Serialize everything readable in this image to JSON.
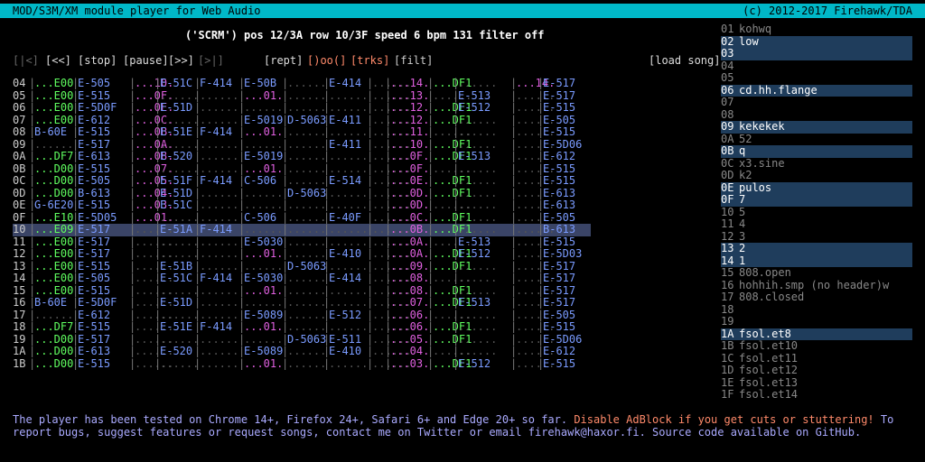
{
  "titlebar": {
    "left": "MOD/S3M/XM module player for Web Audio",
    "right": "(c) 2012-2017 Firehawk/TDA"
  },
  "status": {
    "song": "('SCRM')",
    "pos_label": "pos",
    "pos": "12/3A",
    "row_label": "row",
    "row": "10/3F",
    "speed_label": "speed",
    "speed": "6",
    "bpm_label": "bpm",
    "bpm": "131",
    "filter_label": "filter",
    "filter": "off"
  },
  "controls": {
    "prev": "[|<]",
    "rew": "[<<]",
    "stop": "[stop]",
    "pause": "[pause]",
    "fwd": "[>>]",
    "next": "[>|]",
    "rept": "[rept]",
    "oo": "[)oo(]",
    "trks": "[trks]",
    "filt": "[filt]",
    "load": "[load song]"
  },
  "pattern": {
    "current_row_index": 12,
    "rows": [
      {
        "n": "04",
        "c": [
          "...E00",
          "E-505",
          "...10.",
          "E-51C",
          "F-414",
          "E-50B",
          "......",
          "E-414",
          "......",
          "...14.",
          "...DF1",
          "......",
          "...14.",
          "E-517"
        ]
      },
      {
        "n": "05",
        "c": [
          "...E00",
          "E-515",
          "...0F.",
          "......",
          "......",
          "...01.",
          "......",
          "......",
          "......",
          "...13.",
          "......",
          "E-513",
          "......",
          "E-517"
        ]
      },
      {
        "n": "06",
        "c": [
          "...E00",
          "E-5D0F",
          "...0E.",
          "E-51D",
          "......",
          "......",
          "......",
          "......",
          "......",
          "...12.",
          "...DF1",
          "E-512",
          "......",
          "E-515"
        ]
      },
      {
        "n": "07",
        "c": [
          "...E00",
          "E-612",
          "...0C.",
          "......",
          "......",
          "E-5019",
          "D-5063",
          "E-411",
          "......",
          "...12.",
          "...DF1",
          "......",
          "......",
          "E-505"
        ]
      },
      {
        "n": "08",
        "c": [
          "B-60E",
          "E-515",
          "...0B.",
          "E-51E",
          "F-414",
          "...01.",
          "......",
          "......",
          "......",
          "...11.",
          "......",
          "......",
          "......",
          "E-515"
        ]
      },
      {
        "n": "09",
        "c": [
          "......",
          "E-517",
          "...0A.",
          "......",
          "......",
          "......",
          "......",
          "E-411",
          "......",
          "...10.",
          "...DF1",
          "......",
          "......",
          "E-5D06"
        ]
      },
      {
        "n": "0A",
        "c": [
          "...DF7",
          "E-613",
          "...08.",
          "E-520",
          "......",
          "E-5019",
          "......",
          "......",
          "......",
          "...0F.",
          "...DF1",
          "E-513",
          "......",
          "E-612"
        ]
      },
      {
        "n": "0B",
        "c": [
          "...D00",
          "E-515",
          "...07.",
          "......",
          "......",
          "...01.",
          "......",
          "......",
          "......",
          "...0F.",
          "......",
          "......",
          "......",
          "E-515"
        ]
      },
      {
        "n": "0C",
        "c": [
          "...D00",
          "E-505",
          "...05.",
          "E-51F",
          "F-414",
          "C-506",
          "......",
          "E-514",
          "......",
          "...0E.",
          "...DF1",
          "......",
          "......",
          "E-515"
        ]
      },
      {
        "n": "0D",
        "c": [
          "...D00",
          "B-613",
          "...04.",
          "E-51D",
          "......",
          "......",
          "D-5063",
          "......",
          "......",
          "...0D.",
          "...DF1",
          "......",
          "......",
          "E-613"
        ]
      },
      {
        "n": "0E",
        "c": [
          "G-6E20",
          "E-515",
          "...03.",
          "E-51C",
          "......",
          "......",
          "......",
          "......",
          "......",
          "...0D.",
          "......",
          "......",
          "......",
          "E-613"
        ]
      },
      {
        "n": "0F",
        "c": [
          "...E10",
          "E-5D05",
          "...01.",
          "......",
          "......",
          "C-506",
          "......",
          "E-40F",
          "......",
          "...0C.",
          "...DF1",
          "......",
          "......",
          "E-505"
        ]
      },
      {
        "n": "10",
        "c": [
          "...E09",
          "E-517",
          "......",
          "E-51A",
          "F-414",
          "......",
          "......",
          "......",
          "......",
          "...0B.",
          "...DF1",
          "......",
          "......",
          "B-613"
        ]
      },
      {
        "n": "11",
        "c": [
          "...E00",
          "E-517",
          "......",
          "......",
          "......",
          "E-5030",
          "......",
          "......",
          "......",
          "...0A.",
          "......",
          "E-513",
          "......",
          "E-515"
        ]
      },
      {
        "n": "12",
        "c": [
          "...E00",
          "E-517",
          "......",
          "......",
          "......",
          "...01.",
          "......",
          "E-410",
          "......",
          "...0A.",
          "...DF1",
          "E-512",
          "......",
          "E-5D03"
        ]
      },
      {
        "n": "13",
        "c": [
          "...E00",
          "E-515",
          "......",
          "E-51B",
          "......",
          "......",
          "D-5063",
          "......",
          "......",
          "...09.",
          "...DF1",
          "......",
          "......",
          "E-517"
        ]
      },
      {
        "n": "14",
        "c": [
          "...E00",
          "E-505",
          "......",
          "E-51C",
          "F-414",
          "E-5030",
          "......",
          "E-414",
          "......",
          "...08.",
          "......",
          "......",
          "......",
          "E-517"
        ]
      },
      {
        "n": "15",
        "c": [
          "...E00",
          "E-515",
          "......",
          "......",
          "......",
          "...01.",
          "......",
          "......",
          "......",
          "...08.",
          "...DF1",
          "......",
          "......",
          "E-517"
        ]
      },
      {
        "n": "16",
        "c": [
          "B-60E",
          "E-5D0F",
          "......",
          "E-51D",
          "......",
          "......",
          "......",
          "......",
          "......",
          "...07.",
          "...DF1",
          "E-513",
          "......",
          "E-517"
        ]
      },
      {
        "n": "17",
        "c": [
          "......",
          "E-612",
          "......",
          "......",
          "......",
          "E-5089",
          "......",
          "E-512",
          "......",
          "...06.",
          "......",
          "......",
          "......",
          "E-505"
        ]
      },
      {
        "n": "18",
        "c": [
          "...DF7",
          "E-515",
          "......",
          "E-51E",
          "F-414",
          "...01.",
          "......",
          "......",
          "......",
          "...06.",
          "...DF1",
          "......",
          "......",
          "E-515"
        ]
      },
      {
        "n": "19",
        "c": [
          "...D00",
          "E-517",
          "......",
          "......",
          "......",
          "......",
          "D-5063",
          "E-511",
          "......",
          "...05.",
          "...DF1",
          "......",
          "......",
          "E-5D06"
        ]
      },
      {
        "n": "1A",
        "c": [
          "...D00",
          "E-613",
          "......",
          "E-520",
          "......",
          "E-5089",
          "......",
          "E-410",
          "......",
          "...04.",
          "......",
          "......",
          "......",
          "E-612"
        ]
      },
      {
        "n": "1B",
        "c": [
          "...D00",
          "E-515",
          "......",
          "......",
          "......",
          "...01.",
          "......",
          "......",
          "......",
          "...03.",
          "...DF1",
          "E-512",
          "......",
          "E-515"
        ]
      }
    ]
  },
  "samples": [
    {
      "n": "01",
      "name": "kohwq",
      "hl": false
    },
    {
      "n": "02",
      "name": "low",
      "hl": true
    },
    {
      "n": "03",
      "name": "",
      "hl": true
    },
    {
      "n": "04",
      "name": "",
      "hl": false
    },
    {
      "n": "05",
      "name": "",
      "hl": false
    },
    {
      "n": "06",
      "name": "cd.hh.flange",
      "hl": true
    },
    {
      "n": "07",
      "name": "",
      "hl": false
    },
    {
      "n": "08",
      "name": "",
      "hl": false
    },
    {
      "n": "09",
      "name": "kekekek",
      "hl": true
    },
    {
      "n": "0A",
      "name": "52",
      "hl": false
    },
    {
      "n": "0B",
      "name": "q",
      "hl": true
    },
    {
      "n": "0C",
      "name": "x3.sine",
      "hl": false
    },
    {
      "n": "0D",
      "name": "k2",
      "hl": false
    },
    {
      "n": "0E",
      "name": "pulos",
      "hl": true
    },
    {
      "n": "0F",
      "name": "7",
      "hl": true
    },
    {
      "n": "10",
      "name": "5",
      "hl": false
    },
    {
      "n": "11",
      "name": "4",
      "hl": false
    },
    {
      "n": "12",
      "name": "3",
      "hl": false
    },
    {
      "n": "13",
      "name": "2",
      "hl": true
    },
    {
      "n": "14",
      "name": "1",
      "hl": true
    },
    {
      "n": "15",
      "name": "808.open",
      "hl": false
    },
    {
      "n": "16",
      "name": "hohhih.smp (no header)w",
      "hl": false
    },
    {
      "n": "17",
      "name": "808.closed",
      "hl": false
    },
    {
      "n": "18",
      "name": "",
      "hl": false
    },
    {
      "n": "19",
      "name": "",
      "hl": false
    },
    {
      "n": "1A",
      "name": "fsol.et8",
      "hl": true
    },
    {
      "n": "1B",
      "name": "fsol.et10",
      "hl": false
    },
    {
      "n": "1C",
      "name": "fsol.et11",
      "hl": false
    },
    {
      "n": "1D",
      "name": "fsol.et12",
      "hl": false
    },
    {
      "n": "1E",
      "name": "fsol.et13",
      "hl": false
    },
    {
      "n": "1F",
      "name": "fsol.et14",
      "hl": false
    }
  ],
  "footer": {
    "text1": "The player has been tested on Chrome 14+, Firefox 24+, Safari 6+ and Edge 20+ so far. ",
    "warn": "Disable AdBlock if you get cuts or stuttering!",
    "text2": " To report bugs, suggest features or request songs, contact me on Twitter or email firehawk@haxor.fi. Source code available on GitHub."
  },
  "colors": {
    "titlebar": "#00b8c8",
    "current_row": "#3a4466",
    "sample_highlight": "#1f3d5c",
    "warning": "#ff8a6a",
    "footer_text": "#aaaaff"
  }
}
